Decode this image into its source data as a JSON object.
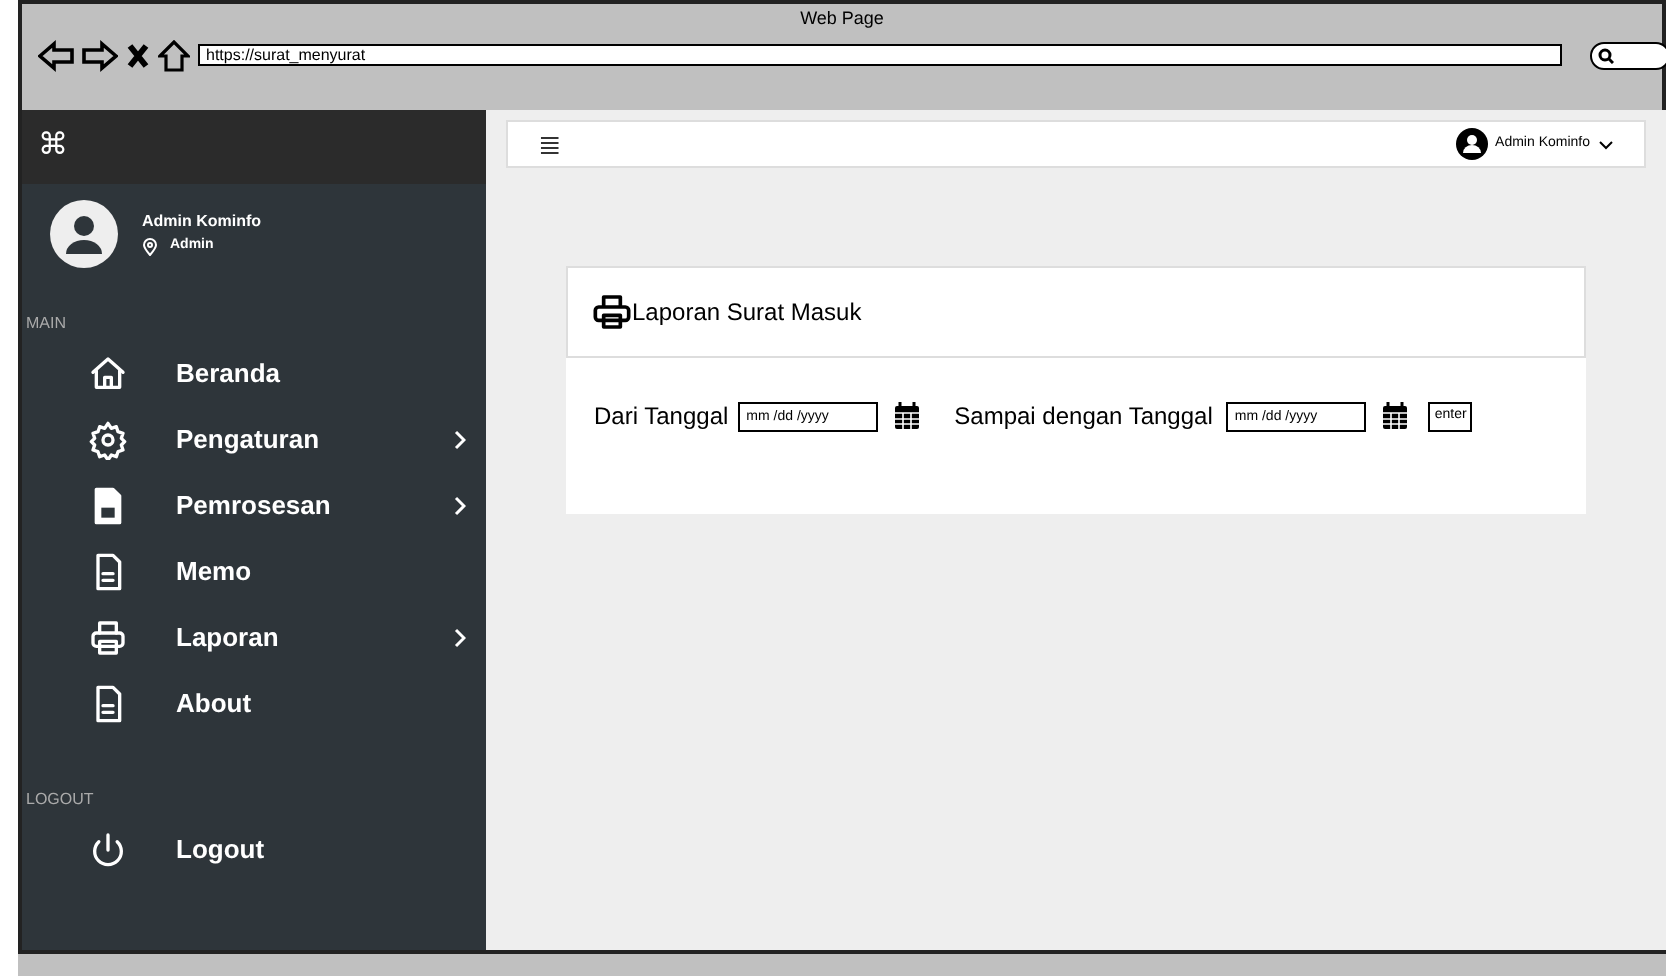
{
  "browser": {
    "title": "Web Page",
    "url": "https://surat_menyurat"
  },
  "sidebar": {
    "logo": "⌘",
    "user": {
      "name": "Admin Kominfo",
      "role": "Admin"
    },
    "sections": [
      {
        "heading": "MAIN",
        "items": [
          {
            "label": "Beranda",
            "has_submenu": false
          },
          {
            "label": "Pengaturan",
            "has_submenu": true
          },
          {
            "label": "Pemrosesan",
            "has_submenu": true
          },
          {
            "label": "Memo",
            "has_submenu": false
          },
          {
            "label": "Laporan",
            "has_submenu": true
          },
          {
            "label": "About",
            "has_submenu": false
          }
        ]
      },
      {
        "heading": "LOGOUT",
        "items": [
          {
            "label": "Logout",
            "has_submenu": false
          }
        ]
      }
    ]
  },
  "topbar": {
    "menu_icon": "≣",
    "user": "Admin Kominfo"
  },
  "card": {
    "title": "Laporan Surat Masuk",
    "from_label": "Dari Tanggal",
    "from_placeholder": "mm /dd /yyyy",
    "to_label": "Sampai dengan Tanggal",
    "to_placeholder": "mm /dd /yyyy",
    "button": "enter"
  }
}
